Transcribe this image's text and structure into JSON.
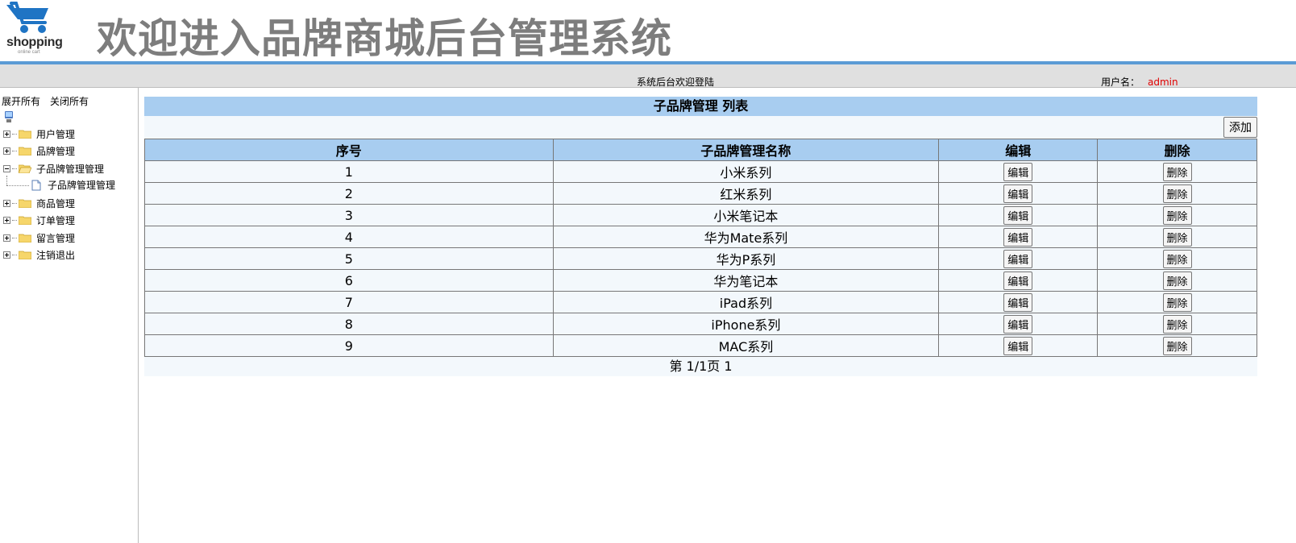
{
  "header": {
    "logo_text": "shopping",
    "logo_sub": "online cart",
    "site_title": "欢迎进入品牌商城后台管理系统"
  },
  "bar": {
    "welcome": "系统后台欢迎登陆",
    "user_label": "用户名：",
    "username": "admin"
  },
  "sidebar": {
    "expand_all": "展开所有",
    "collapse_all": "关闭所有",
    "items": [
      {
        "label": "用户管理"
      },
      {
        "label": "品牌管理"
      },
      {
        "label": "子品牌管理管理"
      },
      {
        "label": "商品管理"
      },
      {
        "label": "订单管理"
      },
      {
        "label": "留言管理"
      },
      {
        "label": "注销退出"
      }
    ],
    "child": "子品牌管理管理"
  },
  "main": {
    "title": "子品牌管理 列表",
    "add_label": "添加",
    "columns": [
      "序号",
      "子品牌管理名称",
      "编辑",
      "删除"
    ],
    "edit_label": "编辑",
    "delete_label": "删除",
    "rows": [
      {
        "id": "1",
        "name": "小米系列"
      },
      {
        "id": "2",
        "name": "红米系列"
      },
      {
        "id": "3",
        "name": "小米笔记本"
      },
      {
        "id": "4",
        "name": "华为Mate系列"
      },
      {
        "id": "5",
        "name": "华为P系列"
      },
      {
        "id": "6",
        "name": "华为笔记本"
      },
      {
        "id": "7",
        "name": "iPad系列"
      },
      {
        "id": "8",
        "name": "iPhone系列"
      },
      {
        "id": "9",
        "name": "MAC系列"
      }
    ],
    "pager": "第 1/1页 1"
  }
}
